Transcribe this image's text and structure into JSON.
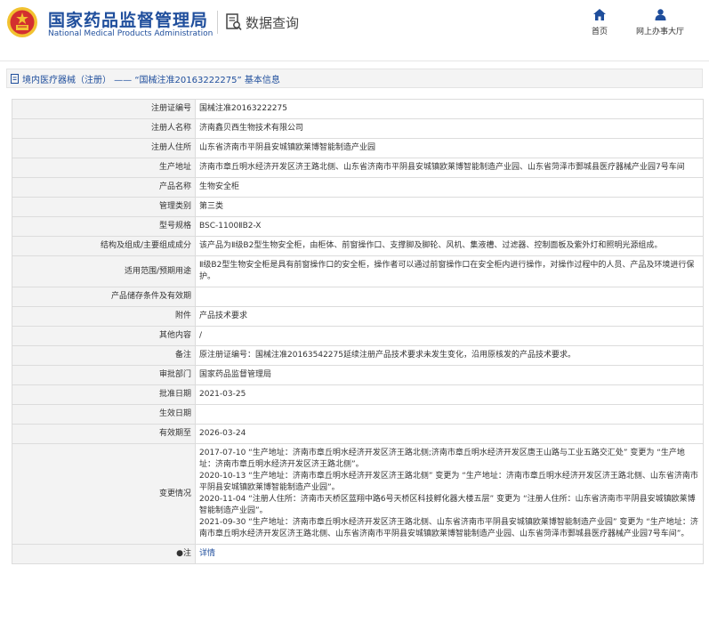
{
  "header": {
    "org_cn": "国家药品监督管理局",
    "org_en": "National Medical Products Administration",
    "query_label": "数据查询",
    "query_icon": "document-search-icon",
    "nav": [
      {
        "label": "首页",
        "icon": "home-icon"
      },
      {
        "label": "网上办事大厅",
        "icon": "user-icon"
      }
    ]
  },
  "breadcrumb": {
    "icon": "document-icon",
    "text": "境内医疗器械（注册） —— “国械注准20163222275” 基本信息"
  },
  "rows": [
    {
      "label": "注册证编号",
      "value": "国械注准20163222275"
    },
    {
      "label": "注册人名称",
      "value": "济南鑫贝西生物技术有限公司"
    },
    {
      "label": "注册人住所",
      "value": "山东省济南市平阴县安城镇欧莱博智能制造产业园"
    },
    {
      "label": "生产地址",
      "value": "济南市章丘明水经济开发区济王路北侧、山东省济南市平阴县安城镇欧莱博智能制造产业园、山东省菏泽市鄄城县医疗器械产业园7号车间"
    },
    {
      "label": "产品名称",
      "value": "生物安全柜"
    },
    {
      "label": "管理类别",
      "value": "第三类"
    },
    {
      "label": "型号规格",
      "value": "BSC-1100ⅡB2-X"
    },
    {
      "label": "结构及组成/主要组成成分",
      "value": "该产品为Ⅱ级B2型生物安全柜，由柜体、前窗操作口、支撑脚及脚轮、风机、集液槽、过滤器、控制面板及紫外灯和照明光源组成。"
    },
    {
      "label": "适用范围/预期用途",
      "value": "Ⅱ级B2型生物安全柜是具有前窗操作口的安全柜，操作者可以通过前窗操作口在安全柜内进行操作，对操作过程中的人员、产品及环境进行保护。"
    },
    {
      "label": "产品储存条件及有效期",
      "value": ""
    },
    {
      "label": "附件",
      "value": "产品技术要求"
    },
    {
      "label": "其他内容",
      "value": "/"
    },
    {
      "label": "备注",
      "value": "原注册证编号：国械注准20163542275延续注册产品技术要求未发生变化，沿用原核发的产品技术要求。"
    },
    {
      "label": "审批部门",
      "value": "国家药品监督管理局"
    },
    {
      "label": "批准日期",
      "value": "2021-03-25"
    },
    {
      "label": "生效日期",
      "value": ""
    },
    {
      "label": "有效期至",
      "value": "2026-03-24"
    }
  ],
  "changes": {
    "label": "变更情况",
    "entries": [
      "2017-07-10 “生产地址：济南市章丘明水经济开发区济王路北侧;济南市章丘明水经济开发区唐王山路与工业五路交汇处” 变更为 “生产地址：济南市章丘明水经济开发区济王路北侧”。",
      "2020-10-13 “生产地址：济南市章丘明水经济开发区济王路北侧” 变更为 “生产地址：济南市章丘明水经济开发区济王路北侧、山东省济南市平阴县安城镇欧莱博智能制造产业园”。",
      "2020-11-04 “注册人住所：济南市天桥区蓝翔中路6号天桥区科技孵化器大楼五层” 变更为 “注册人住所：山东省济南市平阴县安城镇欧莱博智能制造产业园”。",
      "2021-09-30 “生产地址：济南市章丘明水经济开发区济王路北侧、山东省济南市平阴县安城镇欧莱博智能制造产业园” 变更为 “生产地址：济南市章丘明水经济开发区济王路北侧、山东省济南市平阴县安城镇欧莱博智能制造产业园、山东省菏泽市鄄城县医疗器械产业园7号车间”。"
    ]
  },
  "note_row": {
    "label": "●注",
    "value": "详情"
  },
  "colors": {
    "brand": "#1f4e9c",
    "emblem_red": "#d32f2f",
    "emblem_gold": "#f2c230",
    "label_bg": "#f3f3f3",
    "border": "#dcdcdc"
  }
}
